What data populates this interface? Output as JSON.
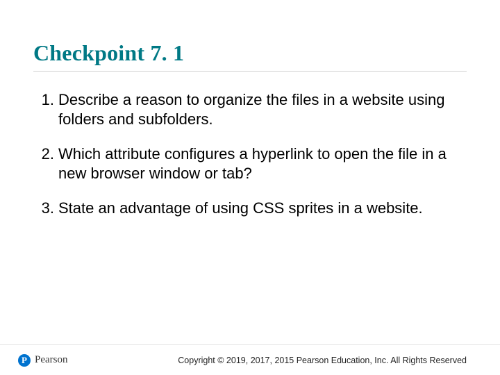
{
  "title": "Checkpoint 7. 1",
  "items": [
    {
      "n": "1.",
      "text": "Describe a reason to organize the files in a website using folders and subfolders."
    },
    {
      "n": "2.",
      "text": "Which attribute configures a hyperlink to open the file in a new browser window or tab?"
    },
    {
      "n": "3.",
      "text": "State an advantage of using CSS sprites in a website."
    }
  ],
  "brand": {
    "mark": "P",
    "name": "Pearson"
  },
  "copyright": "Copyright © 2019, 2017, 2015 Pearson Education, Inc. All Rights Reserved"
}
